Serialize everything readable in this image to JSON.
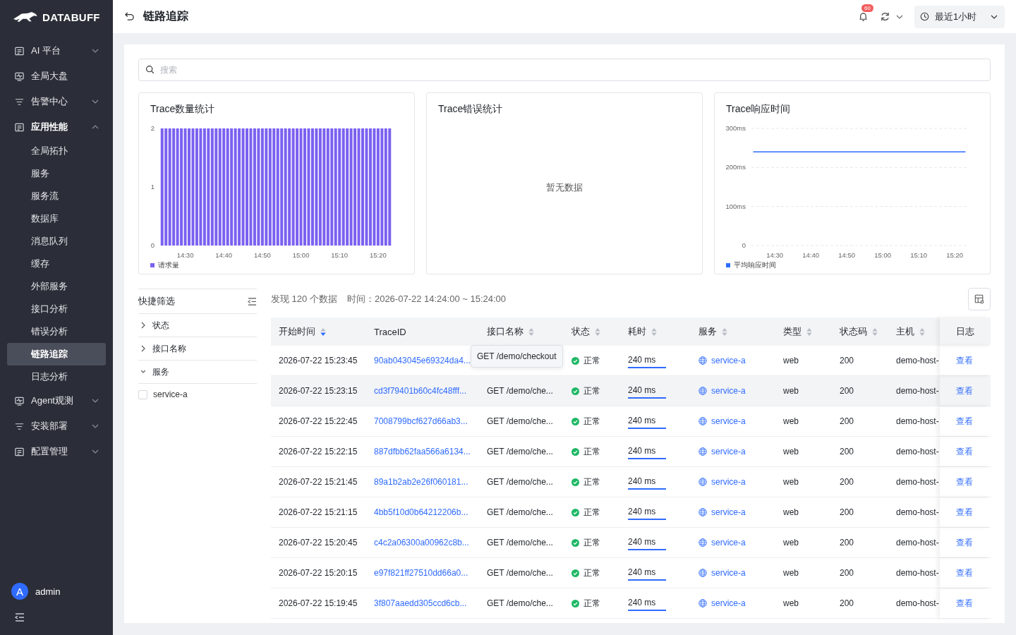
{
  "brand": {
    "name": "DATABUFF"
  },
  "sidebar": {
    "items": [
      {
        "label": "AI 平台",
        "expanded": false
      },
      {
        "label": "全局大盘"
      },
      {
        "label": "告警中心",
        "expanded": false
      },
      {
        "label": "应用性能",
        "expanded": true,
        "children": [
          {
            "label": "全局拓扑",
            "selected": false
          },
          {
            "label": "服务",
            "selected": false
          },
          {
            "label": "服务流",
            "selected": false
          },
          {
            "label": "数据库",
            "selected": false
          },
          {
            "label": "消息队列",
            "selected": false
          },
          {
            "label": "缓存",
            "selected": false
          },
          {
            "label": "外部服务",
            "selected": false
          },
          {
            "label": "接口分析",
            "selected": false
          },
          {
            "label": "错误分析",
            "selected": false
          },
          {
            "label": "链路追踪",
            "selected": true
          },
          {
            "label": "日志分析",
            "selected": false
          }
        ]
      },
      {
        "label": "Agent观测",
        "expanded": false
      },
      {
        "label": "安装部署",
        "expanded": false
      },
      {
        "label": "配置管理",
        "expanded": false
      }
    ],
    "user": {
      "avatar": "A",
      "name": "admin"
    }
  },
  "header": {
    "title": "链路追踪",
    "notification_count": "60",
    "time_range": "最近1小时"
  },
  "search": {
    "placeholder": "搜索"
  },
  "charts": [
    {
      "x_axis_labels": [
        "14:30",
        "14:40",
        "14:50",
        "15:00",
        "15:10",
        "15:20"
      ],
      "chart_data": {
        "type": "bar",
        "title": "Trace数量统计",
        "series": [
          {
            "name": "请求量",
            "color": "#7b61f0",
            "values": [
              2,
              2,
              2,
              2,
              2,
              2,
              2,
              2,
              2,
              2,
              2,
              2,
              2,
              2,
              2,
              2,
              2,
              2,
              2,
              2,
              2,
              2,
              2,
              2,
              2,
              2,
              2,
              2,
              2,
              2,
              2,
              2,
              2,
              2,
              2,
              2,
              2,
              2,
              2,
              2,
              2,
              2,
              2,
              2,
              2,
              2,
              2,
              2,
              2,
              2,
              2,
              2,
              2,
              2,
              2,
              2,
              2,
              2,
              2,
              2
            ]
          }
        ],
        "ylim": [
          0,
          2
        ],
        "yticks": [
          0,
          1,
          2
        ]
      }
    },
    {
      "title": "Trace错误统计",
      "empty_text": "暂无数据"
    },
    {
      "x_axis_labels": [
        "14:30",
        "14:40",
        "14:50",
        "15:00",
        "15:10",
        "15:20"
      ],
      "chart_data": {
        "type": "line",
        "title": "Trace响应时间",
        "series": [
          {
            "name": "平均响应时间",
            "color": "#2f6bff",
            "values": [
              240,
              240,
              240,
              240,
              240,
              240,
              240,
              240,
              240,
              240,
              240,
              240,
              240,
              240,
              240,
              240,
              240,
              240,
              240,
              240,
              240,
              240,
              240,
              240,
              240,
              240,
              240,
              240,
              240,
              240,
              240,
              240,
              240,
              240,
              240,
              240,
              240,
              240,
              240,
              240,
              240,
              240,
              240,
              240,
              240,
              240,
              240,
              240,
              240,
              240,
              240,
              240,
              240,
              240,
              240,
              240,
              240,
              240,
              240,
              240
            ]
          }
        ],
        "ylim": [
          0,
          300
        ],
        "yticks": [
          {
            "value": 0,
            "label": "0"
          },
          {
            "value": 100,
            "label": "100ms"
          },
          {
            "value": 200,
            "label": "200ms"
          },
          {
            "value": 300,
            "label": "300ms"
          }
        ]
      }
    }
  ],
  "filters": {
    "title": "快捷筛选",
    "groups": [
      {
        "label": "状态",
        "expanded": false
      },
      {
        "label": "接口名称",
        "expanded": false
      },
      {
        "label": "服务",
        "expanded": true,
        "options": [
          {
            "label": "service-a",
            "checked": false
          }
        ]
      }
    ]
  },
  "summary": {
    "count": "发现 120 个数据",
    "time": "时间：2026-07-22 14:24:00 ~ 15:24:00"
  },
  "table": {
    "columns": [
      {
        "label": "开始时间",
        "sorted": true
      },
      {
        "label": "TraceID"
      },
      {
        "label": "接口名称",
        "sorted": false
      },
      {
        "label": "状态",
        "sorted": false
      },
      {
        "label": "耗时",
        "sorted": false
      },
      {
        "label": "服务",
        "sorted": false
      },
      {
        "label": "类型",
        "sorted": false
      },
      {
        "label": "状态码",
        "sorted": false
      },
      {
        "label": "主机",
        "sorted": false
      },
      {
        "label": "日志"
      }
    ],
    "rows": [
      {
        "start": "2026-07-22 15:23:45",
        "trace_id": "90ab043045e69324da4...",
        "api": "GET /demo/checkout",
        "tooltip": true,
        "status": "正常",
        "duration": "240 ms",
        "service": "service-a",
        "type": "web",
        "code": "200",
        "host": "demo-host-",
        "log": "查看",
        "hovered": false
      },
      {
        "start": "2026-07-22 15:23:15",
        "trace_id": "cd3f79401b60c4fc48fff...",
        "api": "GET /demo/che...",
        "tooltip": false,
        "status": "正常",
        "duration": "240 ms",
        "service": "service-a",
        "type": "web",
        "code": "200",
        "host": "demo-host-",
        "log": "查看",
        "hovered": true
      },
      {
        "start": "2026-07-22 15:22:45",
        "trace_id": "7008799bcf627d66ab3...",
        "api": "GET /demo/che...",
        "tooltip": false,
        "status": "正常",
        "duration": "240 ms",
        "service": "service-a",
        "type": "web",
        "code": "200",
        "host": "demo-host-",
        "log": "查看",
        "hovered": false
      },
      {
        "start": "2026-07-22 15:22:15",
        "trace_id": "887dfbb62faa566a6134...",
        "api": "GET /demo/che...",
        "tooltip": false,
        "status": "正常",
        "duration": "240 ms",
        "service": "service-a",
        "type": "web",
        "code": "200",
        "host": "demo-host-",
        "log": "查看",
        "hovered": false
      },
      {
        "start": "2026-07-22 15:21:45",
        "trace_id": "89a1b2ab2e26f060181...",
        "api": "GET /demo/che...",
        "tooltip": false,
        "status": "正常",
        "duration": "240 ms",
        "service": "service-a",
        "type": "web",
        "code": "200",
        "host": "demo-host-",
        "log": "查看",
        "hovered": false
      },
      {
        "start": "2026-07-22 15:21:15",
        "trace_id": "4bb5f10d0b64212206b...",
        "api": "GET /demo/che...",
        "tooltip": false,
        "status": "正常",
        "duration": "240 ms",
        "service": "service-a",
        "type": "web",
        "code": "200",
        "host": "demo-host-",
        "log": "查看",
        "hovered": false
      },
      {
        "start": "2026-07-22 15:20:45",
        "trace_id": "c4c2a06300a00962c8b...",
        "api": "GET /demo/che...",
        "tooltip": false,
        "status": "正常",
        "duration": "240 ms",
        "service": "service-a",
        "type": "web",
        "code": "200",
        "host": "demo-host-",
        "log": "查看",
        "hovered": false
      },
      {
        "start": "2026-07-22 15:20:15",
        "trace_id": "e97f821ff27510dd66a0...",
        "api": "GET /demo/che...",
        "tooltip": false,
        "status": "正常",
        "duration": "240 ms",
        "service": "service-a",
        "type": "web",
        "code": "200",
        "host": "demo-host-",
        "log": "查看",
        "hovered": false
      },
      {
        "start": "2026-07-22 15:19:45",
        "trace_id": "3f807aaedd305ccd6cb...",
        "api": "GET /demo/che...",
        "tooltip": false,
        "status": "正常",
        "duration": "240 ms",
        "service": "service-a",
        "type": "web",
        "code": "200",
        "host": "demo-host-",
        "log": "查看",
        "hovered": false
      }
    ]
  }
}
